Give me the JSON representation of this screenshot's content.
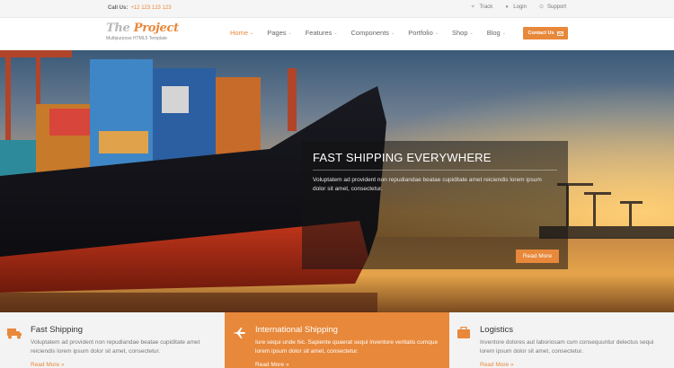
{
  "colors": {
    "accent": "#e8883a",
    "topbar_bg": "#f5f5f5",
    "feature_bg": "#f3f3f3"
  },
  "topbar": {
    "call_label": "Call Us:",
    "phone": "+12 123 123 123",
    "links": [
      {
        "label": "Track",
        "icon": "map-icon"
      },
      {
        "label": "Login",
        "icon": "user-icon"
      },
      {
        "label": "Support",
        "icon": "support-icon"
      }
    ]
  },
  "header": {
    "logo_the": "The",
    "logo_project": "Project",
    "tagline": "Multipurpose HTML5 Template",
    "nav": [
      {
        "label": "Home",
        "active": true
      },
      {
        "label": "Pages"
      },
      {
        "label": "Features"
      },
      {
        "label": "Components"
      },
      {
        "label": "Portfolio"
      },
      {
        "label": "Shop"
      },
      {
        "label": "Blog"
      }
    ],
    "contact_label": "Contact Us"
  },
  "hero": {
    "title": "FAST SHIPPING EVERYWHERE",
    "text": "Voluptatem ad provident non repudiandae beatae cupiditate amet reiciendis lorem ipsum dolor sit amet, consectetur.",
    "button": "Read More"
  },
  "features": [
    {
      "title": "Fast Shipping",
      "icon": "truck-icon",
      "text": "Voluptatem ad provident non repudiandae beatae cupiditate amet reiciendis lorem ipsum dolor sit amet, consectetur.",
      "more": "Read More »"
    },
    {
      "title": "International Shipping",
      "icon": "plane-icon",
      "text": "Iure sequi unde hic. Sapiente quaerat sequi inventore veritatis cumque lorem ipsum dolor sit amet, consectetur.",
      "more": "Read More »"
    },
    {
      "title": "Logistics",
      "icon": "briefcase-icon",
      "text": "Inventore dolores aut laboriosam cum consequuntur delectus sequi lorem ipsum dolor sit amet, consectetur.",
      "more": "Read More »"
    }
  ]
}
